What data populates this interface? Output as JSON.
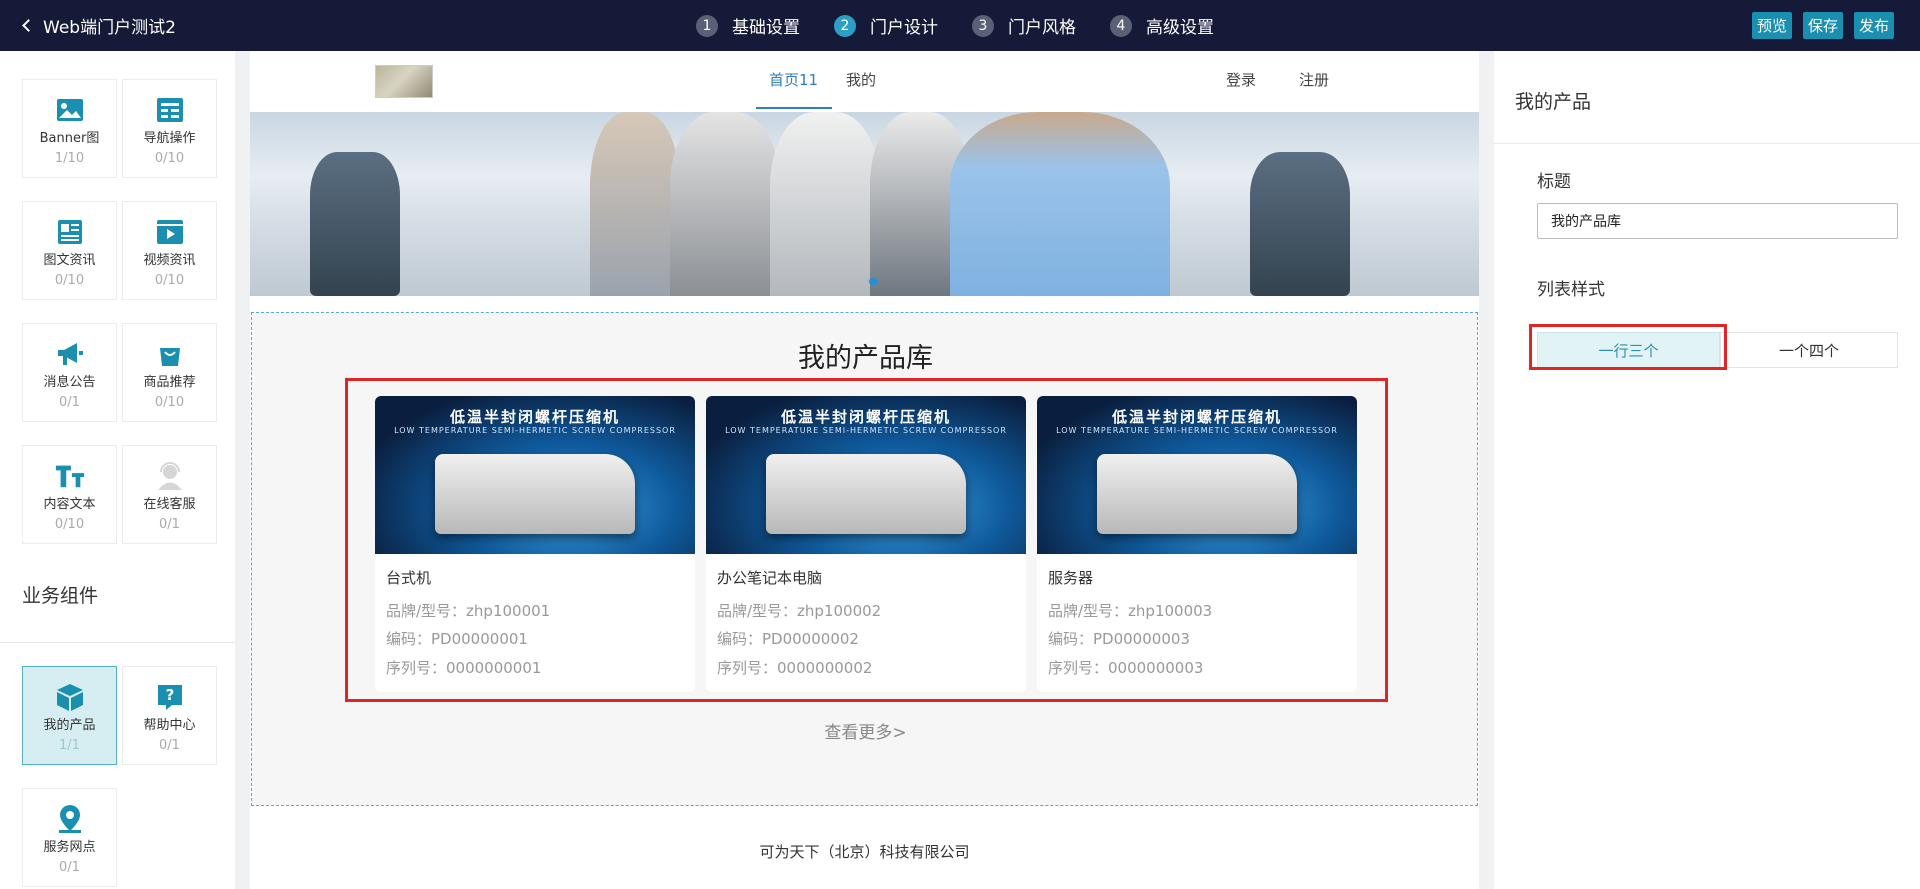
{
  "header": {
    "back_title": "Web端门户测试2",
    "steps": [
      {
        "num": "1",
        "label": "基础设置"
      },
      {
        "num": "2",
        "label": "门户设计"
      },
      {
        "num": "3",
        "label": "门户风格"
      },
      {
        "num": "4",
        "label": "高级设置"
      }
    ],
    "actions": {
      "preview": "预览",
      "save": "保存",
      "publish": "发布"
    }
  },
  "left_panel": {
    "basic_components": [
      {
        "label": "Banner图",
        "count": "1/10",
        "icon": "image-icon"
      },
      {
        "label": "导航操作",
        "count": "0/10",
        "icon": "nav-icon"
      },
      {
        "label": "图文资讯",
        "count": "0/10",
        "icon": "article-icon"
      },
      {
        "label": "视频资讯",
        "count": "0/10",
        "icon": "video-icon"
      },
      {
        "label": "消息公告",
        "count": "0/1",
        "icon": "megaphone-icon"
      },
      {
        "label": "商品推荐",
        "count": "0/10",
        "icon": "shopping-bag-icon"
      },
      {
        "label": "内容文本",
        "count": "0/10",
        "icon": "text-icon"
      },
      {
        "label": "在线客服",
        "count": "0/1",
        "icon": "customer-service-icon"
      }
    ],
    "business_title": "业务组件",
    "business_components": [
      {
        "label": "我的产品",
        "count": "1/1",
        "icon": "box-icon"
      },
      {
        "label": "帮助中心",
        "count": "0/1",
        "icon": "help-icon"
      },
      {
        "label": "服务网点",
        "count": "0/1",
        "icon": "location-icon"
      }
    ]
  },
  "canvas": {
    "nav": {
      "home": "首页11",
      "mine": "我的",
      "login": "登录",
      "register": "注册"
    },
    "products_title": "我的产品库",
    "product_image_title": "低温半封闭螺杆压缩机",
    "product_image_subtitle": "LOW TEMPERATURE SEMI-HERMETIC SCREW COMPRESSOR",
    "products": [
      {
        "name": "台式机",
        "brand": "品牌/型号：zhp100001",
        "code": "编码：PD00000001",
        "serial": "序列号：0000000001"
      },
      {
        "name": "办公笔记本电脑",
        "brand": "品牌/型号：zhp100002",
        "code": "编码：PD00000002",
        "serial": "序列号：0000000002"
      },
      {
        "name": "服务器",
        "brand": "品牌/型号：zhp100003",
        "code": "编码：PD00000003",
        "serial": "序列号：0000000003"
      }
    ],
    "more": "查看更多>",
    "footer": "可为天下（北京）科技有限公司"
  },
  "right_panel": {
    "title": "我的产品",
    "field_title_label": "标题",
    "field_title_value": "我的产品库",
    "list_style_label": "列表样式",
    "style_options": [
      "一行三个",
      "一个四个"
    ],
    "selected_style": "一行三个"
  },
  "colors": {
    "topbar": "#151a38",
    "accent": "#1b8fb0",
    "highlight": "#e02525"
  }
}
